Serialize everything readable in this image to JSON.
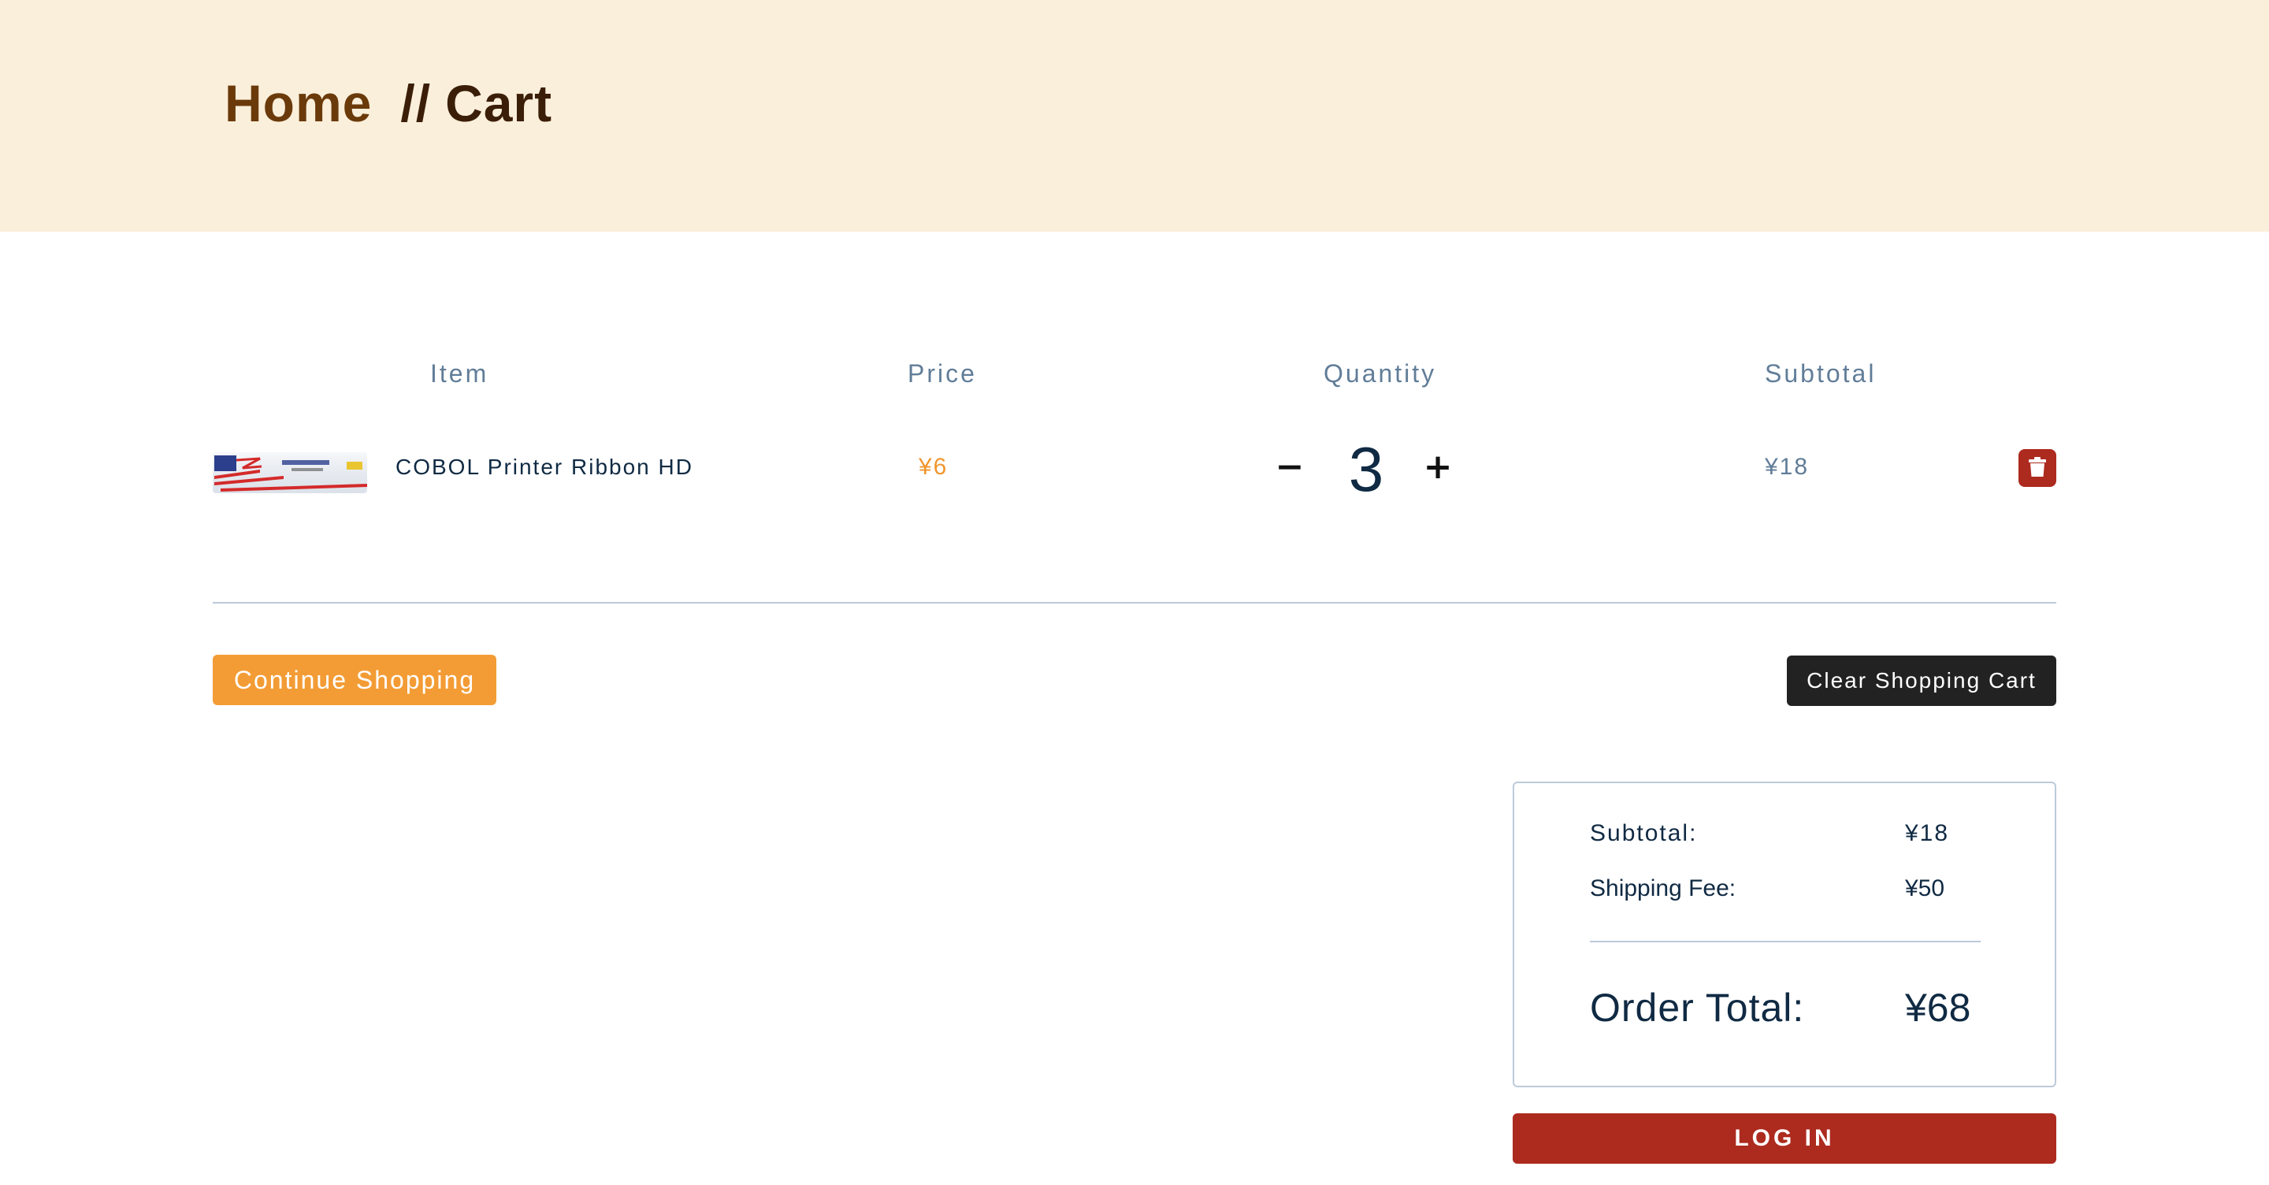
{
  "breadcrumb": {
    "home": "Home",
    "separator": "//",
    "current": "Cart"
  },
  "table": {
    "columns": [
      "Item",
      "Price",
      "Quantity",
      "Subtotal"
    ],
    "rows": [
      {
        "name": "COBOL Printer Ribbon HD",
        "price": "¥6",
        "quantity": "3",
        "subtotal": "¥18",
        "decrement": "−",
        "increment": "+"
      }
    ]
  },
  "actions": {
    "continue": "Continue Shopping",
    "clear": "Clear Shopping Cart"
  },
  "totals": {
    "subtotal_label": "Subtotal:",
    "subtotal_value": "¥18",
    "shipping_label": "Shipping Fee:",
    "shipping_value": "¥50",
    "order_total_label": "Order Total:",
    "order_total_value": "¥68"
  },
  "login": "LOG IN",
  "colors": {
    "hero_bg": "#faefdb",
    "accent_orange": "#f39c35",
    "danger_red": "#ad2a1f",
    "dark_button": "#222222",
    "text_primary": "#102a43",
    "text_muted": "#617d98"
  },
  "icons": {
    "remove": "trash-icon",
    "product": "product-thumbnail"
  }
}
